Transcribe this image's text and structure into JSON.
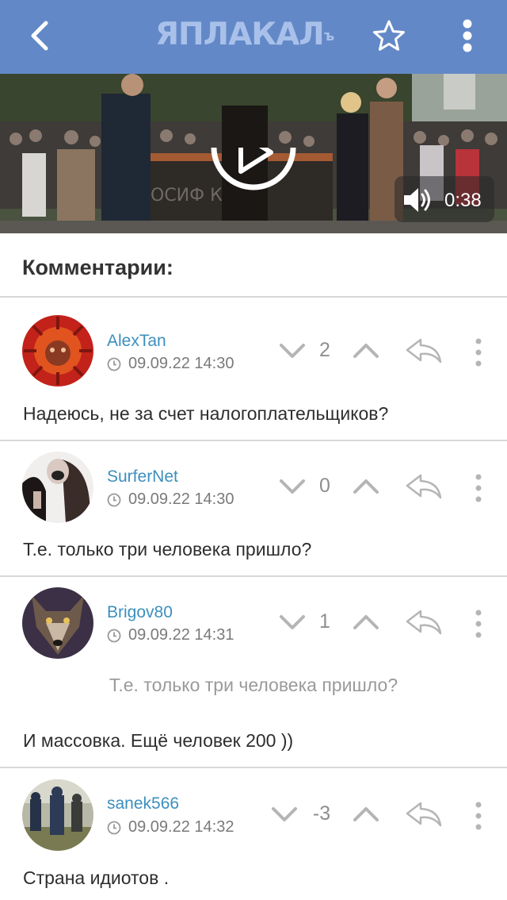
{
  "header": {
    "logo_text": "ЯПЛАКАЛ",
    "logo_suffix": "ъ",
    "back_icon": "chevron-left-icon",
    "star_icon": "star-outline-icon",
    "more_icon": "vertical-dots-icon",
    "color": "#6388c7"
  },
  "video": {
    "duration": "0:38",
    "play_icon": "play-icon",
    "sound_icon": "speaker-icon",
    "monument_text": "ОСИФ КОБ"
  },
  "comments_section": {
    "title": "Комментарии:"
  },
  "comments": [
    {
      "username": "AlexTan",
      "datetime": "09.09.22 14:30",
      "score": "2",
      "text": "Надеюсь, не за счет налогоплательщиков?",
      "quote": ""
    },
    {
      "username": "SurferNet",
      "datetime": "09.09.22 14:30",
      "score": "0",
      "text": "Т.е. только три человека пришло?",
      "quote": ""
    },
    {
      "username": "Brigov80",
      "datetime": "09.09.22 14:31",
      "score": "1",
      "text": "И массовка. Ещё человек 200 ))",
      "quote": "Т.е. только три человека пришло?"
    },
    {
      "username": "sanek566",
      "datetime": "09.09.22 14:32",
      "score": "-3",
      "text": "Страна идиотов .",
      "quote": ""
    }
  ],
  "colors": {
    "username": "#3d8fbd",
    "meta": "#7a7a7a",
    "icon_gray": "#b5b5b5"
  }
}
